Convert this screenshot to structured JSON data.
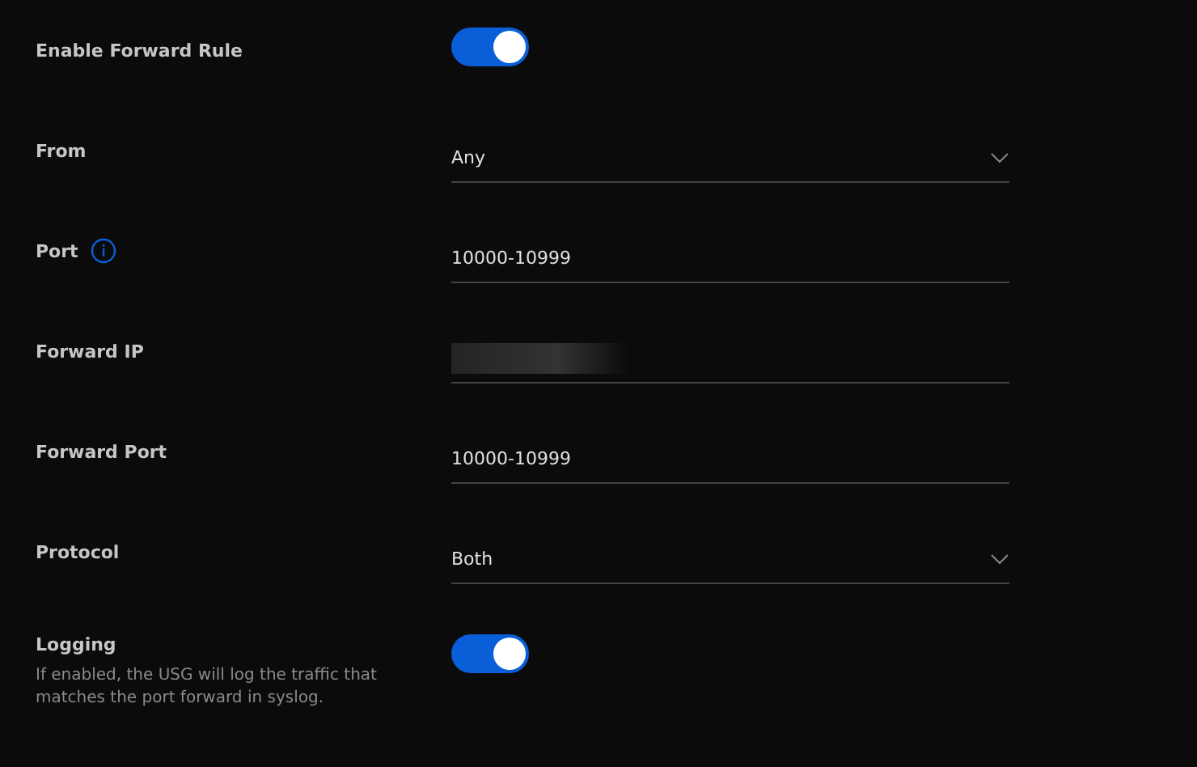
{
  "rows": [
    {
      "kind": "toggle",
      "label": "Enable Forward Rule",
      "on": true
    },
    {
      "kind": "select",
      "label": "From",
      "value": "Any"
    },
    {
      "kind": "text",
      "label": "Port",
      "value": "10000-10999",
      "info": true
    },
    {
      "kind": "text",
      "label": "Forward IP",
      "redacted": true
    },
    {
      "kind": "text",
      "label": "Forward Port",
      "value": "10000-10999"
    },
    {
      "kind": "select",
      "label": "Protocol",
      "value": "Both"
    },
    {
      "kind": "toggle",
      "label": "Logging",
      "on": true,
      "description": "If enabled, the USG will log the traffic that matches the port forward in syslog."
    }
  ]
}
